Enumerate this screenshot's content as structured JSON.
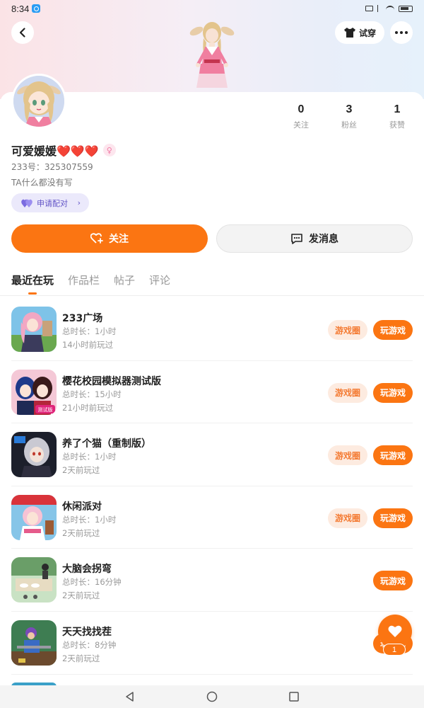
{
  "status_bar": {
    "time": "8:34"
  },
  "header": {
    "tryon_label": "试穿"
  },
  "profile": {
    "name": "可爱媛媛❤️❤️❤️",
    "uid": "233号：325307559",
    "bio": "TA什么都没有写",
    "match_label": "申请配对",
    "stats": [
      {
        "num": "0",
        "label": "关注"
      },
      {
        "num": "3",
        "label": "粉丝"
      },
      {
        "num": "1",
        "label": "获赞"
      }
    ],
    "follow_label": "关注",
    "message_label": "发消息"
  },
  "tabs": [
    "最近在玩",
    "作品栏",
    "帖子",
    "评论"
  ],
  "games": [
    {
      "title": "233广场",
      "duration": "总时长：1小时",
      "last_played": "14小时前玩过",
      "has_circle": true,
      "circle_label": "游戏圈",
      "play_label": "玩游戏"
    },
    {
      "title": "樱花校园模拟器测试版",
      "duration": "总时长：15小时",
      "last_played": "21小时前玩过",
      "has_circle": true,
      "circle_label": "游戏圈",
      "play_label": "玩游戏"
    },
    {
      "title": "养了个猫（重制版）",
      "duration": "总时长：1小时",
      "last_played": "2天前玩过",
      "has_circle": true,
      "circle_label": "游戏圈",
      "play_label": "玩游戏"
    },
    {
      "title": "休闲派对",
      "duration": "总时长：1小时",
      "last_played": "2天前玩过",
      "has_circle": true,
      "circle_label": "游戏圈",
      "play_label": "玩游戏"
    },
    {
      "title": "大脑会拐弯",
      "duration": "总时长：16分钟",
      "last_played": "2天前玩过",
      "has_circle": false,
      "circle_label": "",
      "play_label": "玩游戏"
    },
    {
      "title": "天天找找茬",
      "duration": "总时长：8分钟",
      "last_played": "2天前玩过",
      "has_circle": false,
      "circle_label": "",
      "play_label": "玩游戏"
    }
  ],
  "fab": {
    "count": "1"
  },
  "colors": {
    "accent": "#fb7512",
    "accent_soft": "#fdebe0",
    "match_bg": "#ebe9fb",
    "match_text": "#6254c7"
  }
}
